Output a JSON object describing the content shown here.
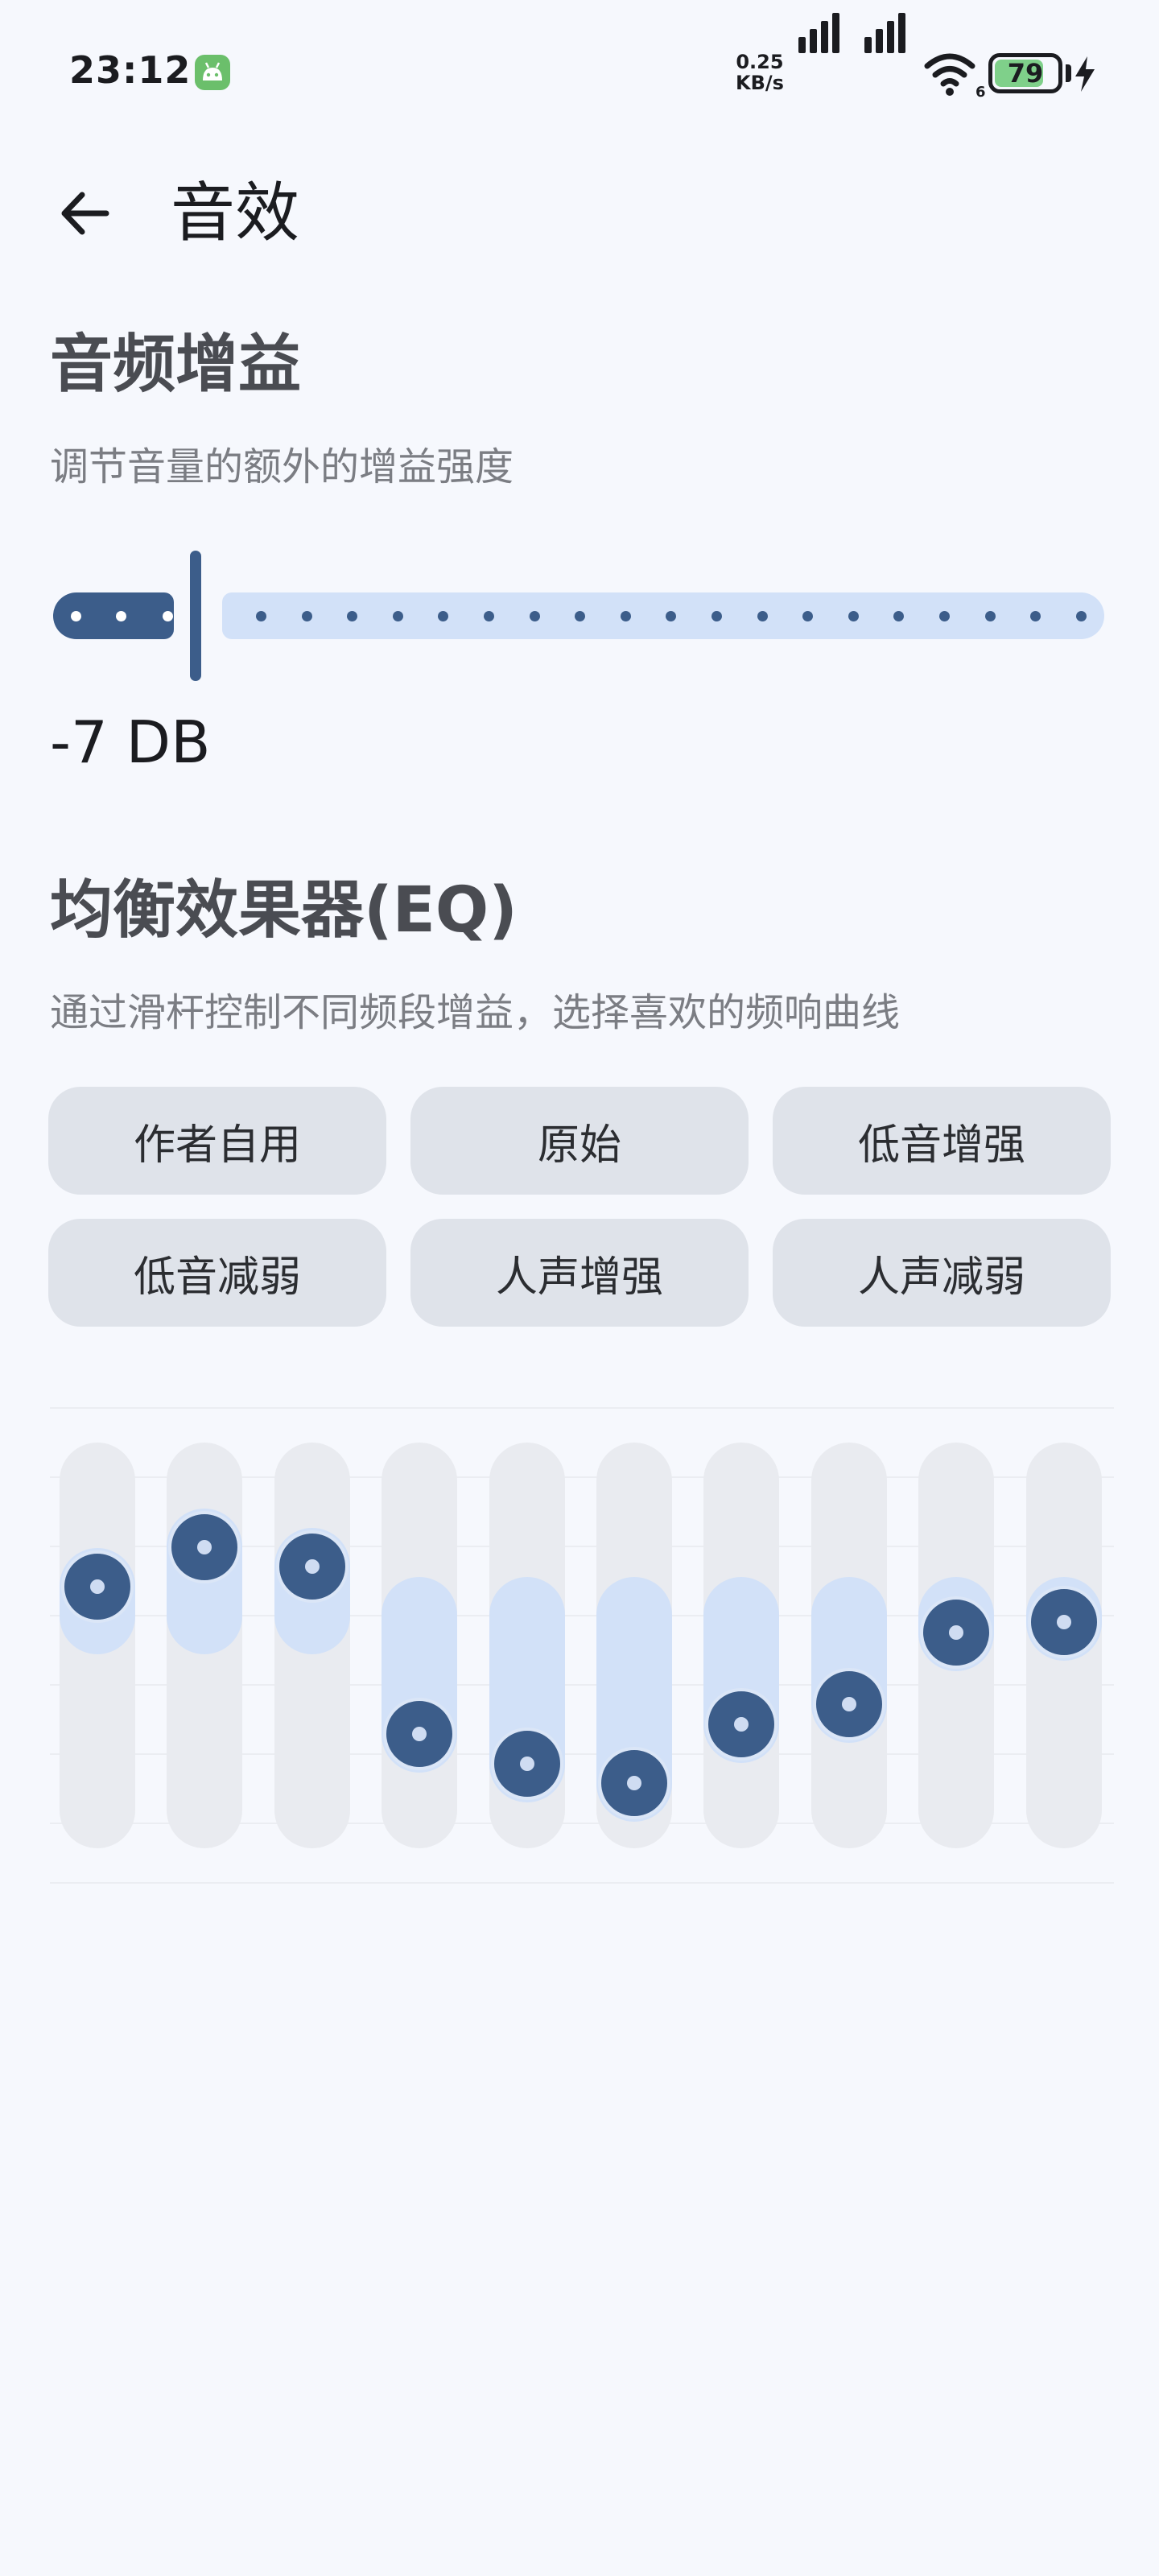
{
  "status_bar": {
    "time": "23:12",
    "net_speed_value": "0.25",
    "net_speed_unit": "KB/s",
    "wifi_label": "6",
    "battery_percent": "79",
    "battery_level": 0.79,
    "charging": true
  },
  "header": {
    "title": "音效",
    "back_icon": "arrow-left-icon"
  },
  "gain": {
    "title": "音频增益",
    "description": "调节音量的额外的增益强度",
    "value_label": "-7 DB",
    "level": 0.1
  },
  "eq": {
    "title": "均衡效果器(EQ)",
    "description": "通过滑杆控制不同频段增益，选择喜欢的频响曲线",
    "presets": [
      "作者自用",
      "原始",
      "低音增强",
      "低音减弱",
      "人声增强",
      "人声减弱"
    ],
    "bands": [
      0.68,
      0.8,
      0.74,
      0.23,
      0.14,
      0.08,
      0.26,
      0.32,
      0.54,
      0.57
    ],
    "center": 0.59
  },
  "colors": {
    "accent": "#3c5d8a",
    "track_light": "#d2e1f8",
    "band_bg": "#e9ebf0",
    "background": "#f6f8fd",
    "chip_bg": "#dfe3ea"
  }
}
